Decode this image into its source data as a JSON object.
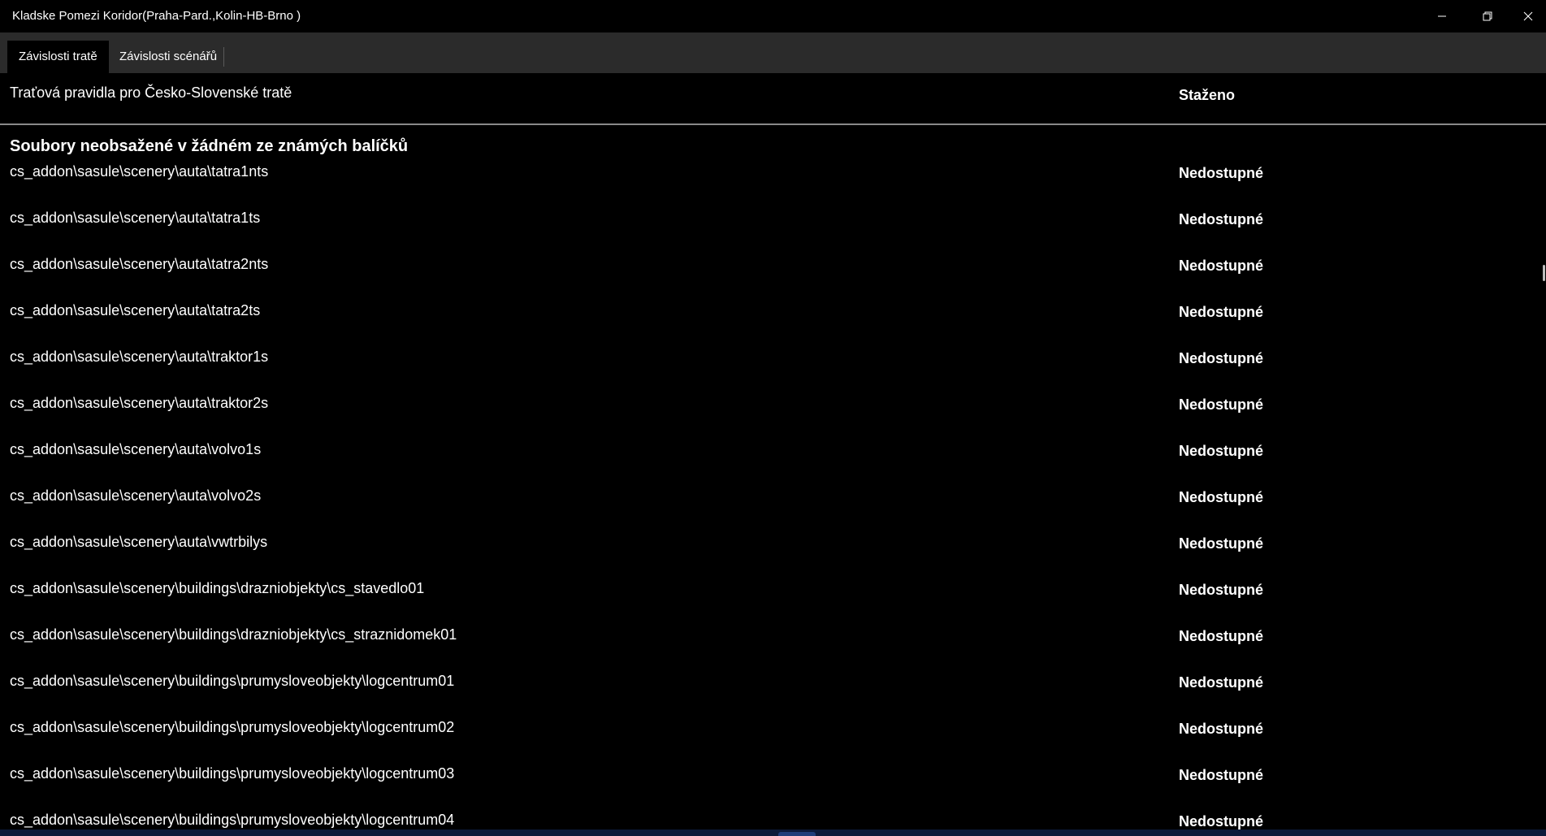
{
  "window": {
    "title": "Kladske Pomezi Koridor(Praha-Pard.,Kolin-HB-Brno )",
    "controls": {
      "minimize_icon": "minimize-icon",
      "restore_icon": "restore-icon",
      "close_icon": "close-icon"
    }
  },
  "tabs": [
    {
      "label": "Závislosti tratě",
      "active": true
    },
    {
      "label": "Závislosti scénářů",
      "active": false
    }
  ],
  "rules": {
    "name": "Traťová pravidla pro Česko-Slovenské tratě",
    "status": "Staženo"
  },
  "section": {
    "heading": "Soubory neobsažené v žádném ze známých balíčků"
  },
  "files": [
    {
      "path": "cs_addon\\sasule\\scenery\\auta\\tatra1nts",
      "status": "Nedostupné"
    },
    {
      "path": "cs_addon\\sasule\\scenery\\auta\\tatra1ts",
      "status": "Nedostupné"
    },
    {
      "path": "cs_addon\\sasule\\scenery\\auta\\tatra2nts",
      "status": "Nedostupné"
    },
    {
      "path": "cs_addon\\sasule\\scenery\\auta\\tatra2ts",
      "status": "Nedostupné"
    },
    {
      "path": "cs_addon\\sasule\\scenery\\auta\\traktor1s",
      "status": "Nedostupné"
    },
    {
      "path": "cs_addon\\sasule\\scenery\\auta\\traktor2s",
      "status": "Nedostupné"
    },
    {
      "path": "cs_addon\\sasule\\scenery\\auta\\volvo1s",
      "status": "Nedostupné"
    },
    {
      "path": "cs_addon\\sasule\\scenery\\auta\\volvo2s",
      "status": "Nedostupné"
    },
    {
      "path": "cs_addon\\sasule\\scenery\\auta\\vwtrbilys",
      "status": "Nedostupné"
    },
    {
      "path": "cs_addon\\sasule\\scenery\\buildings\\drazniobjekty\\cs_stavedlo01",
      "status": "Nedostupné"
    },
    {
      "path": "cs_addon\\sasule\\scenery\\buildings\\drazniobjekty\\cs_straznidomek01",
      "status": "Nedostupné"
    },
    {
      "path": "cs_addon\\sasule\\scenery\\buildings\\prumysloveobjekty\\logcentrum01",
      "status": "Nedostupné"
    },
    {
      "path": "cs_addon\\sasule\\scenery\\buildings\\prumysloveobjekty\\logcentrum02",
      "status": "Nedostupné"
    },
    {
      "path": "cs_addon\\sasule\\scenery\\buildings\\prumysloveobjekty\\logcentrum03",
      "status": "Nedostupné"
    },
    {
      "path": "cs_addon\\sasule\\scenery\\buildings\\prumysloveobjekty\\logcentrum04",
      "status": "Nedostupné"
    }
  ]
}
